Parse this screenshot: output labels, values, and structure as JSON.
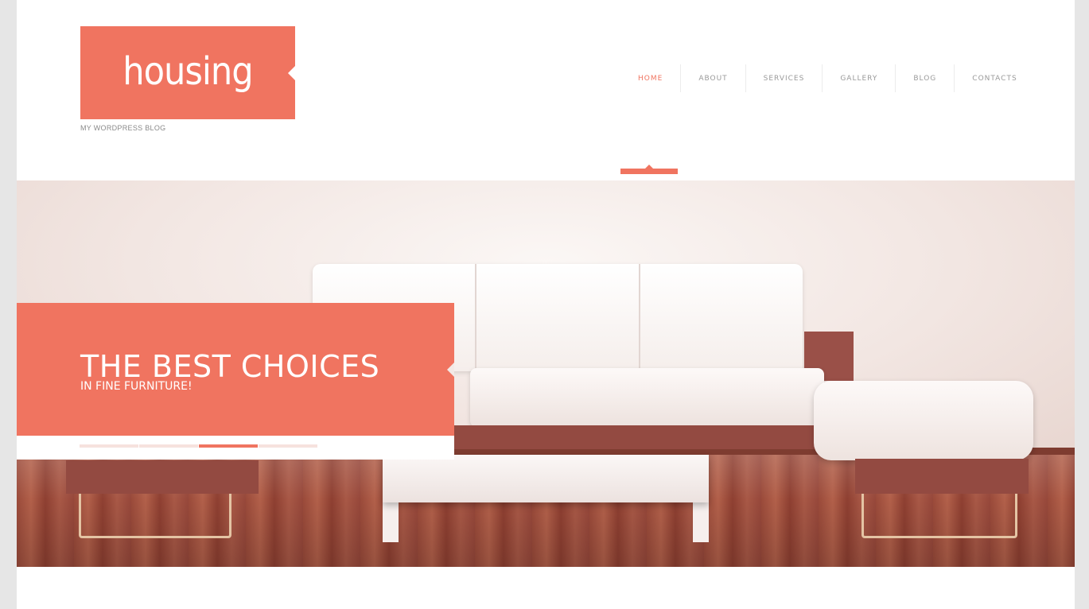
{
  "brand": {
    "logo_text": "housing",
    "tagline": "MY WORDPRESS BLOG"
  },
  "nav": {
    "items": [
      {
        "label": "HOME",
        "active": true
      },
      {
        "label": "ABOUT",
        "active": false
      },
      {
        "label": "SERVICES",
        "active": false
      },
      {
        "label": "GALLERY",
        "active": false
      },
      {
        "label": "BLOG",
        "active": false
      },
      {
        "label": "CONTACTS",
        "active": false
      }
    ]
  },
  "slider": {
    "title": "THE BEST CHOICES",
    "subtitle": "IN FINE FURNITURE!",
    "slide_count": 4,
    "active_slide": 3
  },
  "colors": {
    "accent": "#f07460",
    "nav_text": "#9a9a9a",
    "page_bg": "#e6e6e6",
    "content_bg": "#ffffff"
  }
}
